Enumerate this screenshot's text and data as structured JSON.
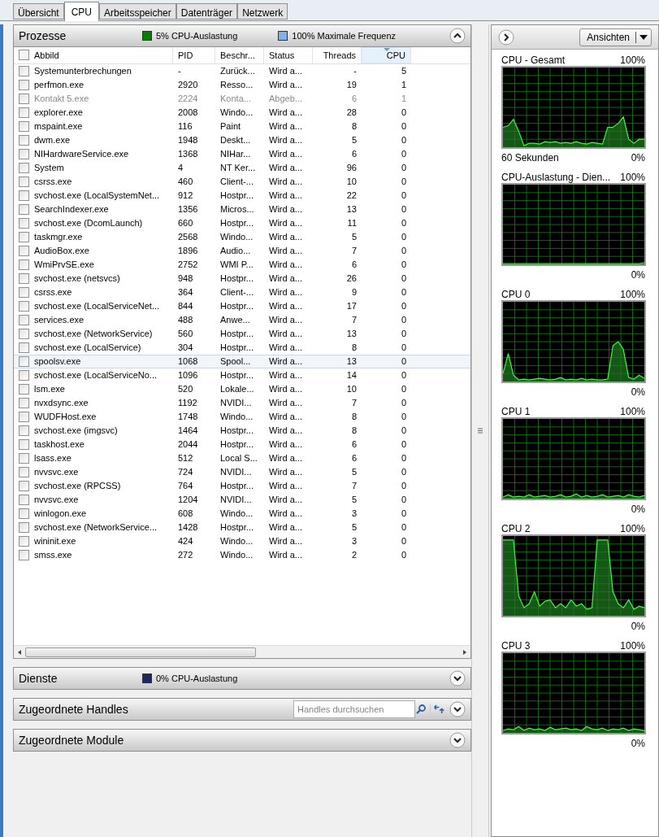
{
  "tabs": [
    {
      "label": "Übersicht",
      "selected": false
    },
    {
      "label": "CPU",
      "selected": true
    },
    {
      "label": "Arbeitsspeicher",
      "selected": false
    },
    {
      "label": "Datenträger",
      "selected": false
    },
    {
      "label": "Netzwerk",
      "selected": false
    }
  ],
  "processes": {
    "title": "Prozesse",
    "legend": [
      {
        "text": "5% CPU-Auslastung",
        "color": "#008000"
      },
      {
        "text": "100% Maximale Frequenz",
        "color": "#7fb2e5"
      }
    ],
    "expanded": true,
    "select_all_checked": false,
    "columns": [
      {
        "label": "Abbild",
        "sorted": false
      },
      {
        "label": "PID",
        "sorted": false
      },
      {
        "label": "Beschr...",
        "sorted": false
      },
      {
        "label": "Status",
        "sorted": false
      },
      {
        "label": "Threads",
        "sorted": false
      },
      {
        "label": "CPU",
        "sorted": true
      }
    ],
    "rows": [
      {
        "cells": [
          "Systemunterbrechungen",
          "-",
          "Zurück...",
          "Wird a...",
          "-",
          "5"
        ],
        "disabled": false,
        "selected": false
      },
      {
        "cells": [
          "perfmon.exe",
          "2920",
          "Resso...",
          "Wird a...",
          "19",
          "1"
        ],
        "disabled": false,
        "selected": false
      },
      {
        "cells": [
          "Kontakt 5.exe",
          "2224",
          "Konta...",
          "Abgeb...",
          "6",
          "1"
        ],
        "disabled": true,
        "selected": false
      },
      {
        "cells": [
          "explorer.exe",
          "2008",
          "Windo...",
          "Wird a...",
          "28",
          "0"
        ],
        "disabled": false,
        "selected": false
      },
      {
        "cells": [
          "mspaint.exe",
          "116",
          "Paint",
          "Wird a...",
          "8",
          "0"
        ],
        "disabled": false,
        "selected": false
      },
      {
        "cells": [
          "dwm.exe",
          "1948",
          "Deskt...",
          "Wird a...",
          "5",
          "0"
        ],
        "disabled": false,
        "selected": false
      },
      {
        "cells": [
          "NIHardwareService.exe",
          "1368",
          "NIHar...",
          "Wird a...",
          "6",
          "0"
        ],
        "disabled": false,
        "selected": false
      },
      {
        "cells": [
          "System",
          "4",
          "NT Ker...",
          "Wird a...",
          "96",
          "0"
        ],
        "disabled": false,
        "selected": false
      },
      {
        "cells": [
          "csrss.exe",
          "460",
          "Client-...",
          "Wird a...",
          "10",
          "0"
        ],
        "disabled": false,
        "selected": false
      },
      {
        "cells": [
          "svchost.exe (LocalSystemNet...",
          "912",
          "Hostpr...",
          "Wird a...",
          "22",
          "0"
        ],
        "disabled": false,
        "selected": false
      },
      {
        "cells": [
          "SearchIndexer.exe",
          "1356",
          "Micros...",
          "Wird a...",
          "13",
          "0"
        ],
        "disabled": false,
        "selected": false
      },
      {
        "cells": [
          "svchost.exe (DcomLaunch)",
          "660",
          "Hostpr...",
          "Wird a...",
          "11",
          "0"
        ],
        "disabled": false,
        "selected": false
      },
      {
        "cells": [
          "taskmgr.exe",
          "2568",
          "Windo...",
          "Wird a...",
          "5",
          "0"
        ],
        "disabled": false,
        "selected": false
      },
      {
        "cells": [
          "AudioBox.exe",
          "1896",
          "Audio...",
          "Wird a...",
          "7",
          "0"
        ],
        "disabled": false,
        "selected": false
      },
      {
        "cells": [
          "WmiPrvSE.exe",
          "2752",
          "WMI P...",
          "Wird a...",
          "6",
          "0"
        ],
        "disabled": false,
        "selected": false
      },
      {
        "cells": [
          "svchost.exe (netsvcs)",
          "948",
          "Hostpr...",
          "Wird a...",
          "26",
          "0"
        ],
        "disabled": false,
        "selected": false
      },
      {
        "cells": [
          "csrss.exe",
          "364",
          "Client-...",
          "Wird a...",
          "9",
          "0"
        ],
        "disabled": false,
        "selected": false
      },
      {
        "cells": [
          "svchost.exe (LocalServiceNet...",
          "844",
          "Hostpr...",
          "Wird a...",
          "17",
          "0"
        ],
        "disabled": false,
        "selected": false
      },
      {
        "cells": [
          "services.exe",
          "488",
          "Anwe...",
          "Wird a...",
          "7",
          "0"
        ],
        "disabled": false,
        "selected": false
      },
      {
        "cells": [
          "svchost.exe (NetworkService)",
          "560",
          "Hostpr...",
          "Wird a...",
          "13",
          "0"
        ],
        "disabled": false,
        "selected": false
      },
      {
        "cells": [
          "svchost.exe (LocalService)",
          "304",
          "Hostpr...",
          "Wird a...",
          "8",
          "0"
        ],
        "disabled": false,
        "selected": false
      },
      {
        "cells": [
          "spoolsv.exe",
          "1068",
          "Spool...",
          "Wird a...",
          "13",
          "0"
        ],
        "disabled": false,
        "selected": true
      },
      {
        "cells": [
          "svchost.exe (LocalServiceNo...",
          "1096",
          "Hostpr...",
          "Wird a...",
          "14",
          "0"
        ],
        "disabled": false,
        "selected": false
      },
      {
        "cells": [
          "lsm.exe",
          "520",
          "Lokale...",
          "Wird a...",
          "10",
          "0"
        ],
        "disabled": false,
        "selected": false
      },
      {
        "cells": [
          "nvxdsync.exe",
          "1192",
          "NVIDI...",
          "Wird a...",
          "7",
          "0"
        ],
        "disabled": false,
        "selected": false
      },
      {
        "cells": [
          "WUDFHost.exe",
          "1748",
          "Windo...",
          "Wird a...",
          "8",
          "0"
        ],
        "disabled": false,
        "selected": false
      },
      {
        "cells": [
          "svchost.exe (imgsvc)",
          "1464",
          "Hostpr...",
          "Wird a...",
          "8",
          "0"
        ],
        "disabled": false,
        "selected": false
      },
      {
        "cells": [
          "taskhost.exe",
          "2044",
          "Hostpr...",
          "Wird a...",
          "6",
          "0"
        ],
        "disabled": false,
        "selected": false
      },
      {
        "cells": [
          "lsass.exe",
          "512",
          "Local S...",
          "Wird a...",
          "6",
          "0"
        ],
        "disabled": false,
        "selected": false
      },
      {
        "cells": [
          "nvvsvc.exe",
          "724",
          "NVIDI...",
          "Wird a...",
          "5",
          "0"
        ],
        "disabled": false,
        "selected": false
      },
      {
        "cells": [
          "svchost.exe (RPCSS)",
          "764",
          "Hostpr...",
          "Wird a...",
          "7",
          "0"
        ],
        "disabled": false,
        "selected": false
      },
      {
        "cells": [
          "nvvsvc.exe",
          "1204",
          "NVIDI...",
          "Wird a...",
          "5",
          "0"
        ],
        "disabled": false,
        "selected": false
      },
      {
        "cells": [
          "winlogon.exe",
          "608",
          "Windo...",
          "Wird a...",
          "3",
          "0"
        ],
        "disabled": false,
        "selected": false
      },
      {
        "cells": [
          "svchost.exe (NetworkService...",
          "1428",
          "Hostpr...",
          "Wird a...",
          "5",
          "0"
        ],
        "disabled": false,
        "selected": false
      },
      {
        "cells": [
          "wininit.exe",
          "424",
          "Windo...",
          "Wird a...",
          "3",
          "0"
        ],
        "disabled": false,
        "selected": false
      },
      {
        "cells": [
          "smss.exe",
          "272",
          "Windo...",
          "Wird a...",
          "2",
          "0"
        ],
        "disabled": false,
        "selected": false
      }
    ]
  },
  "sections": [
    {
      "title": "Dienste",
      "legend": {
        "text": "0% CPU-Auslastung",
        "color": "#1a2a5a"
      },
      "expanded": false
    },
    {
      "title": "Zugeordnete Handles",
      "search": {
        "placeholder": "Handles durchsuchen"
      },
      "expanded": false
    },
    {
      "title": "Zugeordnete Module",
      "expanded": false
    }
  ],
  "graphs_panel": {
    "views_button": "Ansichten",
    "graphs": [
      {
        "title": "CPU - Gesamt",
        "max": "100%",
        "footer_left": "60 Sekunden",
        "min": "0%"
      },
      {
        "title": "CPU-Auslastung - Dien...",
        "max": "100%",
        "min": "0%"
      },
      {
        "title": "CPU 0",
        "max": "100%",
        "min": "0%"
      },
      {
        "title": "CPU 1",
        "max": "100%",
        "min": "0%"
      },
      {
        "title": "CPU 2",
        "max": "100%",
        "min": "0%"
      },
      {
        "title": "CPU 3",
        "max": "100%",
        "min": "0%"
      }
    ]
  }
}
